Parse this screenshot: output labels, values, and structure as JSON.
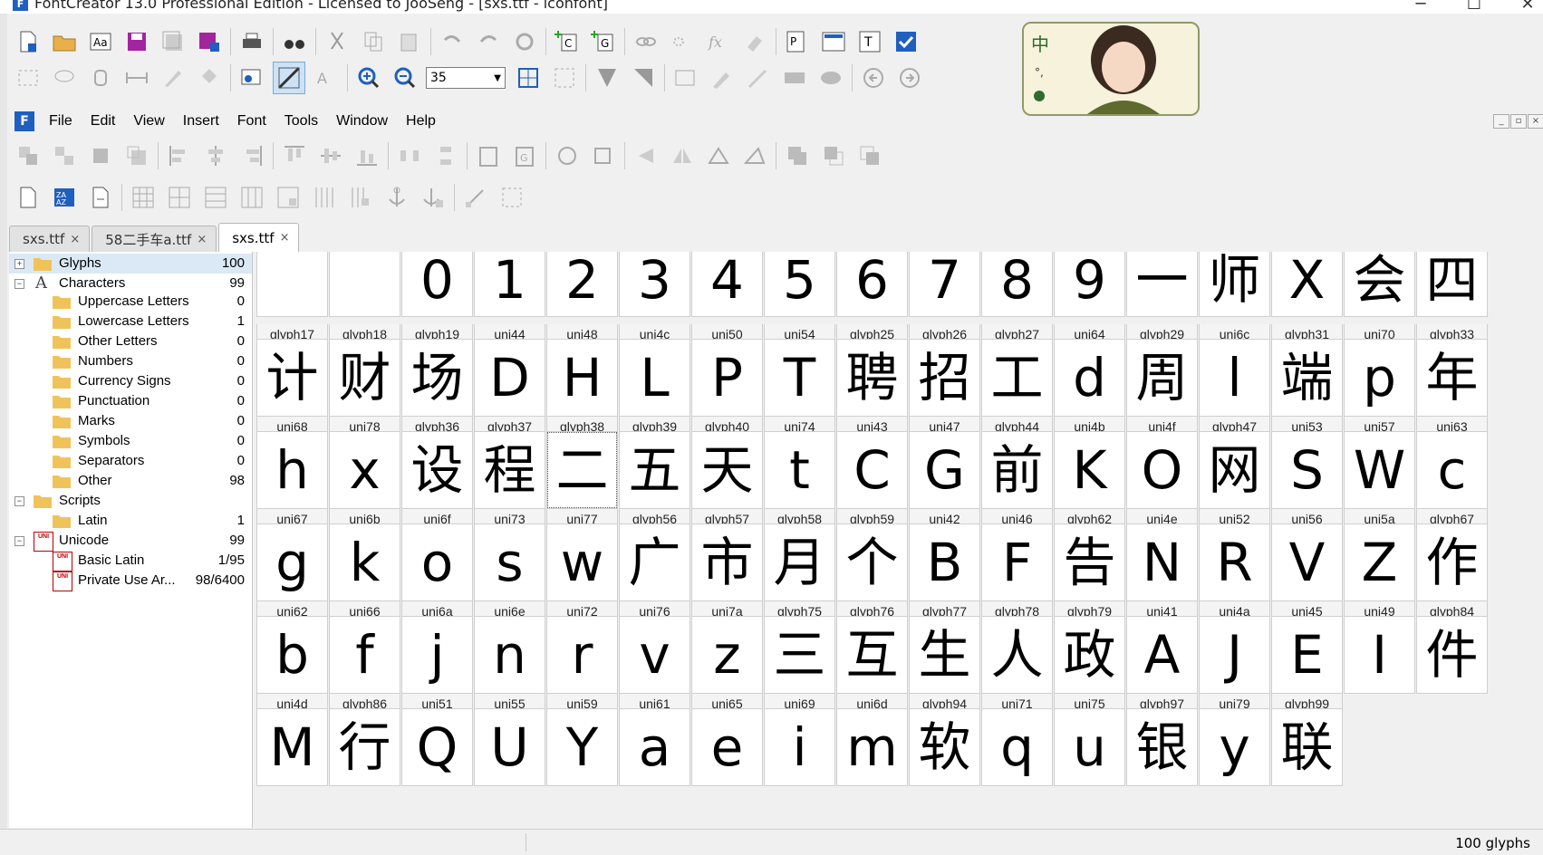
{
  "window": {
    "title": "FontCreator 13.0 Professional Edition - Licensed to JooSeng - [sxs.ttf - iconfont]"
  },
  "toolbar": {
    "zoom_value": "35"
  },
  "menu": {
    "items": [
      "File",
      "Edit",
      "View",
      "Insert",
      "Font",
      "Tools",
      "Window",
      "Help"
    ]
  },
  "tabs": [
    {
      "label": "sxs.ttf",
      "active": false
    },
    {
      "label": "58二手车a.ttf",
      "active": false
    },
    {
      "label": "sxs.ttf",
      "active": true
    }
  ],
  "tree": {
    "glyphs": {
      "label": "Glyphs",
      "count": "100"
    },
    "characters": {
      "label": "Characters",
      "count": "99"
    },
    "uppercase": {
      "label": "Uppercase Letters",
      "count": "0"
    },
    "lowercase": {
      "label": "Lowercase Letters",
      "count": "1"
    },
    "other_letters": {
      "label": "Other Letters",
      "count": "0"
    },
    "numbers": {
      "label": "Numbers",
      "count": "0"
    },
    "currency": {
      "label": "Currency Signs",
      "count": "0"
    },
    "punctuation": {
      "label": "Punctuation",
      "count": "0"
    },
    "marks": {
      "label": "Marks",
      "count": "0"
    },
    "symbols": {
      "label": "Symbols",
      "count": "0"
    },
    "separators": {
      "label": "Separators",
      "count": "0"
    },
    "other": {
      "label": "Other",
      "count": "98"
    },
    "scripts": {
      "label": "Scripts",
      "count": ""
    },
    "latin": {
      "label": "Latin",
      "count": "1"
    },
    "unicode": {
      "label": "Unicode",
      "count": "99"
    },
    "basic_latin": {
      "label": "Basic Latin",
      "count": "1/95"
    },
    "private_use": {
      "label": "Private Use Ar...",
      "count": "98/6400"
    }
  },
  "glyph_rows": [
    {
      "glyphs": [
        "",
        "",
        "0",
        "1",
        "2",
        "3",
        "4",
        "5",
        "6",
        "7",
        "8",
        "9",
        "一",
        "师",
        "X",
        "会",
        "四"
      ],
      "names": [
        "glyph17",
        "glyph18",
        "glyph19",
        "uni44",
        "uni48",
        "uni4c",
        "uni50",
        "uni54",
        "glyph25",
        "glyph26",
        "glyph27",
        "uni64",
        "glyph29",
        "uni6c",
        "glyph31",
        "uni70",
        "glyph33"
      ]
    },
    {
      "glyphs": [
        "计",
        "财",
        "场",
        "D",
        "H",
        "L",
        "P",
        "T",
        "聘",
        "招",
        "工",
        "d",
        "周",
        "l",
        "端",
        "p",
        "年"
      ],
      "names": [
        "uni68",
        "uni78",
        "glyph36",
        "glyph37",
        "glyph38",
        "glyph39",
        "glyph40",
        "uni74",
        "uni43",
        "uni47",
        "glyph44",
        "uni4b",
        "uni4f",
        "glyph47",
        "uni53",
        "uni57",
        "uni63"
      ]
    },
    {
      "glyphs": [
        "h",
        "x",
        "设",
        "程",
        "二",
        "五",
        "天",
        "t",
        "C",
        "G",
        "前",
        "K",
        "O",
        "网",
        "S",
        "W",
        "c"
      ],
      "names": [
        "uni67",
        "uni6b",
        "uni6f",
        "uni73",
        "uni77",
        "glyph56",
        "glyph57",
        "glyph58",
        "glyph59",
        "uni42",
        "uni46",
        "glyph62",
        "uni4e",
        "uni52",
        "uni56",
        "uni5a",
        "glyph67"
      ]
    },
    {
      "glyphs": [
        "g",
        "k",
        "o",
        "s",
        "w",
        "广",
        "市",
        "月",
        "个",
        "B",
        "F",
        "告",
        "N",
        "R",
        "V",
        "Z",
        "作"
      ],
      "names": [
        "uni62",
        "uni66",
        "uni6a",
        "uni6e",
        "uni72",
        "uni76",
        "uni7a",
        "glyph75",
        "glyph76",
        "glyph77",
        "glyph78",
        "glyph79",
        "uni41",
        "uni4a",
        "uni45",
        "uni49",
        "glyph84"
      ]
    },
    {
      "glyphs": [
        "b",
        "f",
        "j",
        "n",
        "r",
        "v",
        "z",
        "三",
        "互",
        "生",
        "人",
        "政",
        "A",
        "J",
        "E",
        "I",
        "件"
      ],
      "names": [
        "uni4d",
        "glyph86",
        "uni51",
        "uni55",
        "uni59",
        "uni61",
        "uni65",
        "uni69",
        "uni6d",
        "glyph94",
        "uni71",
        "uni75",
        "glyph97",
        "uni79",
        "glyph99",
        "",
        ""
      ]
    },
    {
      "glyphs": [
        "M",
        "行",
        "Q",
        "U",
        "Y",
        "a",
        "e",
        "i",
        "m",
        "软",
        "q",
        "u",
        "银",
        "y",
        "联"
      ],
      "names": []
    }
  ],
  "status": {
    "glyph_count": "100 glyphs"
  }
}
